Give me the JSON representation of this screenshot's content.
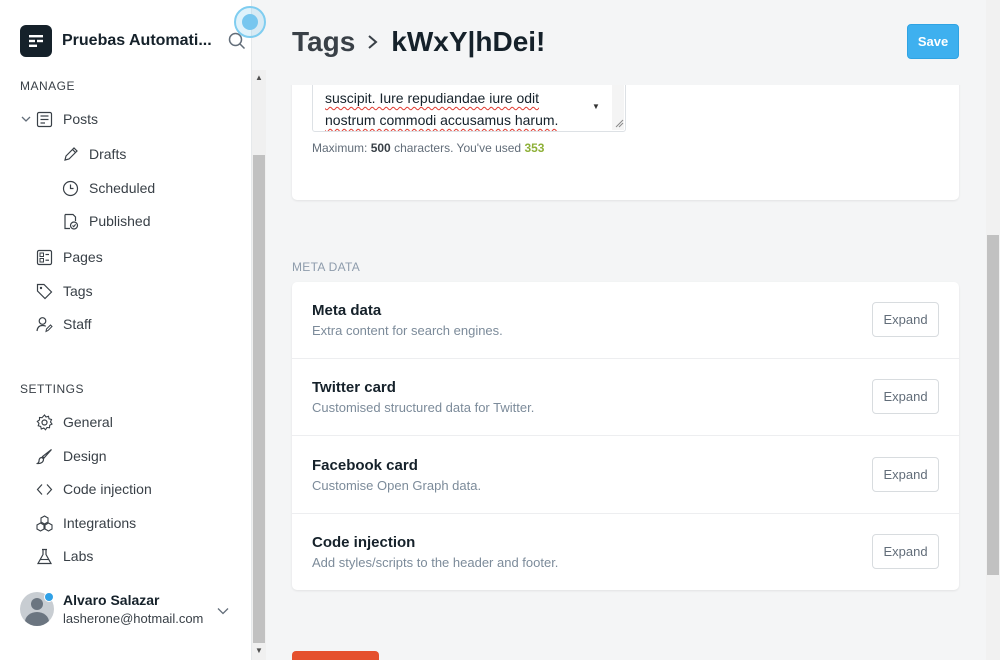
{
  "sidebar": {
    "site_title": "Pruebas Automati...",
    "manage_title": "MANAGE",
    "settings_title": "SETTINGS",
    "manage_items": [
      {
        "label": "Posts",
        "icon": "posts-icon"
      },
      {
        "label": "Drafts",
        "icon": "pencil-icon"
      },
      {
        "label": "Scheduled",
        "icon": "clock-icon"
      },
      {
        "label": "Published",
        "icon": "published-icon"
      },
      {
        "label": "Pages",
        "icon": "pages-icon"
      },
      {
        "label": "Tags",
        "icon": "tag-icon"
      },
      {
        "label": "Staff",
        "icon": "staff-icon"
      }
    ],
    "settings_items": [
      {
        "label": "General",
        "icon": "gear-icon"
      },
      {
        "label": "Design",
        "icon": "brush-icon"
      },
      {
        "label": "Code injection",
        "icon": "code-icon"
      },
      {
        "label": "Integrations",
        "icon": "integrations-icon"
      },
      {
        "label": "Labs",
        "icon": "flask-icon"
      }
    ],
    "user": {
      "name": "Alvaro Salazar",
      "email": "lasherone@hotmail.com"
    }
  },
  "header": {
    "parent": "Tags",
    "title": "kWxY|hDei!",
    "save_label": "Save"
  },
  "description": {
    "lines": [
      "suscipit. Iure repudiandae iure odit",
      "nostrum commodi accusamus harum."
    ],
    "counter_prefix": "Maximum:",
    "max": "500",
    "counter_mid": "characters. You've used",
    "used": "353"
  },
  "meta": {
    "section_title": "META DATA",
    "rows": [
      {
        "title": "Meta data",
        "desc": "Extra content for search engines.",
        "button": "Expand"
      },
      {
        "title": "Twitter card",
        "desc": "Customised structured data for Twitter.",
        "button": "Expand"
      },
      {
        "title": "Facebook card",
        "desc": "Customise Open Graph data.",
        "button": "Expand"
      },
      {
        "title": "Code injection",
        "desc": "Add styles/scripts to the header and footer.",
        "button": "Expand"
      }
    ]
  },
  "colors": {
    "accent": "#3eb0ef",
    "danger": "#e5502d",
    "used_count": "#8eb038"
  }
}
